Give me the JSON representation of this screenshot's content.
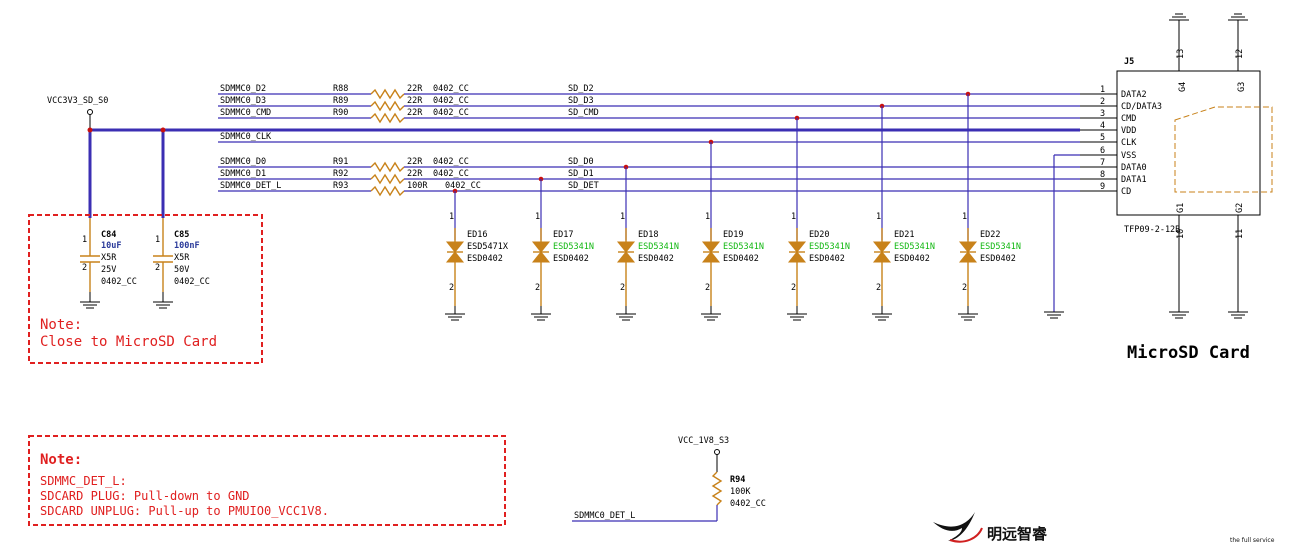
{
  "power": {
    "vcc3v3": "VCC3V3_SD_S0",
    "vcc1v8": "VCC_1V8_S3"
  },
  "nets": [
    {
      "id": "d2",
      "left": "SDMMC0_D2",
      "ref": "R88",
      "val": "22R",
      "pkg": "0402_CC",
      "right": "SD_D2"
    },
    {
      "id": "d3",
      "left": "SDMMC0_D3",
      "ref": "R89",
      "val": "22R",
      "pkg": "0402_CC",
      "right": "SD_D3"
    },
    {
      "id": "cmd",
      "left": "SDMMC0_CMD",
      "ref": "R90",
      "val": "22R",
      "pkg": "0402_CC",
      "right": "SD_CMD"
    },
    {
      "id": "clk",
      "left": "SDMMC0_CLK"
    },
    {
      "id": "d0",
      "left": "SDMMC0_D0",
      "ref": "R91",
      "val": "22R",
      "pkg": "0402_CC",
      "right": "SD_D0"
    },
    {
      "id": "d1",
      "left": "SDMMC0_D1",
      "ref": "R92",
      "val": "22R",
      "pkg": "0402_CC",
      "right": "SD_D1"
    },
    {
      "id": "det",
      "left": "SDMMC0_DET_L",
      "ref": "R93",
      "val": "100R",
      "pkg": "0402_CC",
      "right": "SD_DET"
    }
  ],
  "caps": [
    {
      "ref": "C84",
      "val": "10uF",
      "diel": "X5R",
      "volt": "25V",
      "pkg": "0402_CC"
    },
    {
      "ref": "C85",
      "val": "100nF",
      "diel": "X5R",
      "volt": "50V",
      "pkg": "0402_CC"
    }
  ],
  "esd": [
    {
      "ref": "ED16",
      "part": "ESD5471X",
      "pkg": "ESD0402"
    },
    {
      "ref": "ED17",
      "part": "ESD5341N",
      "pkg": "ESD0402"
    },
    {
      "ref": "ED18",
      "part": "ESD5341N",
      "pkg": "ESD0402"
    },
    {
      "ref": "ED19",
      "part": "ESD5341N",
      "pkg": "ESD0402"
    },
    {
      "ref": "ED20",
      "part": "ESD5341N",
      "pkg": "ESD0402"
    },
    {
      "ref": "ED21",
      "part": "ESD5341N",
      "pkg": "ESD0402"
    },
    {
      "ref": "ED22",
      "part": "ESD5341N",
      "pkg": "ESD0402"
    }
  ],
  "connector": {
    "ref": "J5",
    "part": "TFP09-2-12B",
    "pins": [
      {
        "num": "1",
        "name": "DATA2"
      },
      {
        "num": "2",
        "name": "CD/DATA3"
      },
      {
        "num": "3",
        "name": "CMD"
      },
      {
        "num": "4",
        "name": "VDD"
      },
      {
        "num": "5",
        "name": "CLK"
      },
      {
        "num": "6",
        "name": "VSS"
      },
      {
        "num": "7",
        "name": "DATA0"
      },
      {
        "num": "8",
        "name": "DATA1"
      },
      {
        "num": "9",
        "name": "CD"
      }
    ],
    "shield": {
      "g1": "G1",
      "g2": "G2",
      "g3": "G3",
      "g4": "G4",
      "p10": "10",
      "p11": "11",
      "p12": "12",
      "p13": "13"
    }
  },
  "pullup": {
    "ref": "R94",
    "val": "100K",
    "pkg": "0402_CC",
    "net": "SDMMC0_DET_L"
  },
  "pin_labels": {
    "one": "1",
    "two": "2"
  },
  "title": "MicroSD Card",
  "note1": {
    "title": "Note:",
    "body": "Close to MicroSD Card"
  },
  "note2": {
    "title": "Note:",
    "lines": [
      "SDMMC_DET_L:",
      "SDCARD PLUG:   Pull-down to GND",
      "SDCARD UNPLUG: Pull-up to PMUIO0_VCC1V8."
    ]
  },
  "logo": {
    "text": "明远智睿",
    "tagline": "the full service"
  },
  "colors": {
    "wire": "#3b2fb3",
    "component": "#c8821a",
    "note": "#e02020",
    "value": "#12b812"
  }
}
